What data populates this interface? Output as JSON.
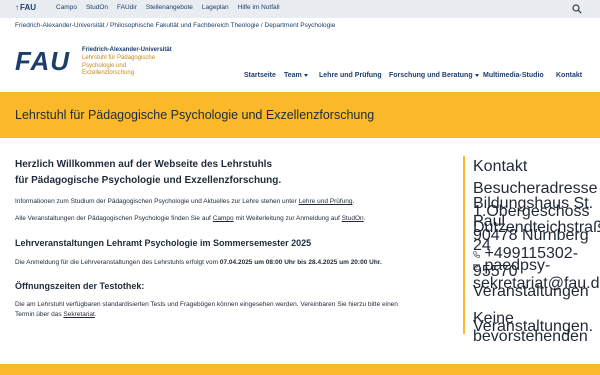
{
  "topbar": {
    "home_label": "FAU",
    "links": [
      "Campo",
      "StudOn",
      "FAUdir",
      "Stellenangebote",
      "Lageplan",
      "Hilfe im Notfall"
    ],
    "search_icon": "search-icon"
  },
  "breadcrumb": "Friedrich-Alexander-Universität / Philosophische Fakultät und Fachbereich Theologie / Department Psychologie",
  "logo": {
    "wordmark": "FAU",
    "line1": "Friedrich-Alexander-Universität",
    "line2": "Lehrstuhl für Pädagogische Psychologie und Exzellenzforschung"
  },
  "nav": {
    "items": [
      "Startseite",
      "Team",
      "Lehre und Prüfung",
      "Forschung und Beratung",
      "Multimedia-Studio",
      "Kontakt"
    ]
  },
  "banner_title": "Lehrstuhl für Pädagogische Psychologie und Exzellenzforschung",
  "main": {
    "welcome_line1": "Herzlich Willkommen auf der Webseite des Lehrstuhls",
    "welcome_line2": "für Pädagogische Psychologie und Exzellenzforschung.",
    "intro_text": "Informationen zum Studium der Pädagogischen Psychologie und Aktuelles zur Lehre stehen unter",
    "intro_link": "Lehre und Prüfung",
    "events_text_a": "Alle Veranstaltungen der Pädagogischen Psychologie finden Sie auf",
    "events_link_campo": "Campo",
    "events_text_b": "mit Weiterleitung zur Anmeldung auf",
    "events_link_studon": "StudOn",
    "section1_title": "Lehrveranstaltungen Lehramt Psychologie im Sommersemester 2025",
    "section1_text_a": "Die Anmeldung für die Lehrveranstaltungen des Lehrstuhls erfolgt vom",
    "section1_bold": "07.04.2025 um 08:00 Uhr bis 28.4.2025 um 20:00 Uhr.",
    "section2_title": "Öffnungszeiten der Testothek:",
    "section2_line1": "Die am Lehrstuhl verfügbaren standardisierten Tests und Fragebögen können eingesehen werden. Vereinbaren Sie hierzu bitte einen",
    "section2_line2_a": "Termin über das",
    "section2_link": "Sekretariat"
  },
  "sidebar": {
    "contact_title": "Kontakt",
    "visitor_title": "Besucheradresse",
    "address_line1": "Bildungshaus St. Paul",
    "address_line2": "1.Obergeschoss",
    "address_line3": "Dutzendteichstraße 24",
    "address_line4": "90478 Nürnberg",
    "phone": "+499115302-95570",
    "email": "paedpsy-sekretariat@fau.de",
    "events_title": "Veranstaltungen",
    "events_line1": "Keine bevorstehenden",
    "events_line2": "Veranstaltungen."
  },
  "colors": {
    "accent": "#fbb829",
    "brand": "#1d3e6b",
    "topbar_bg": "#e9edf2"
  }
}
